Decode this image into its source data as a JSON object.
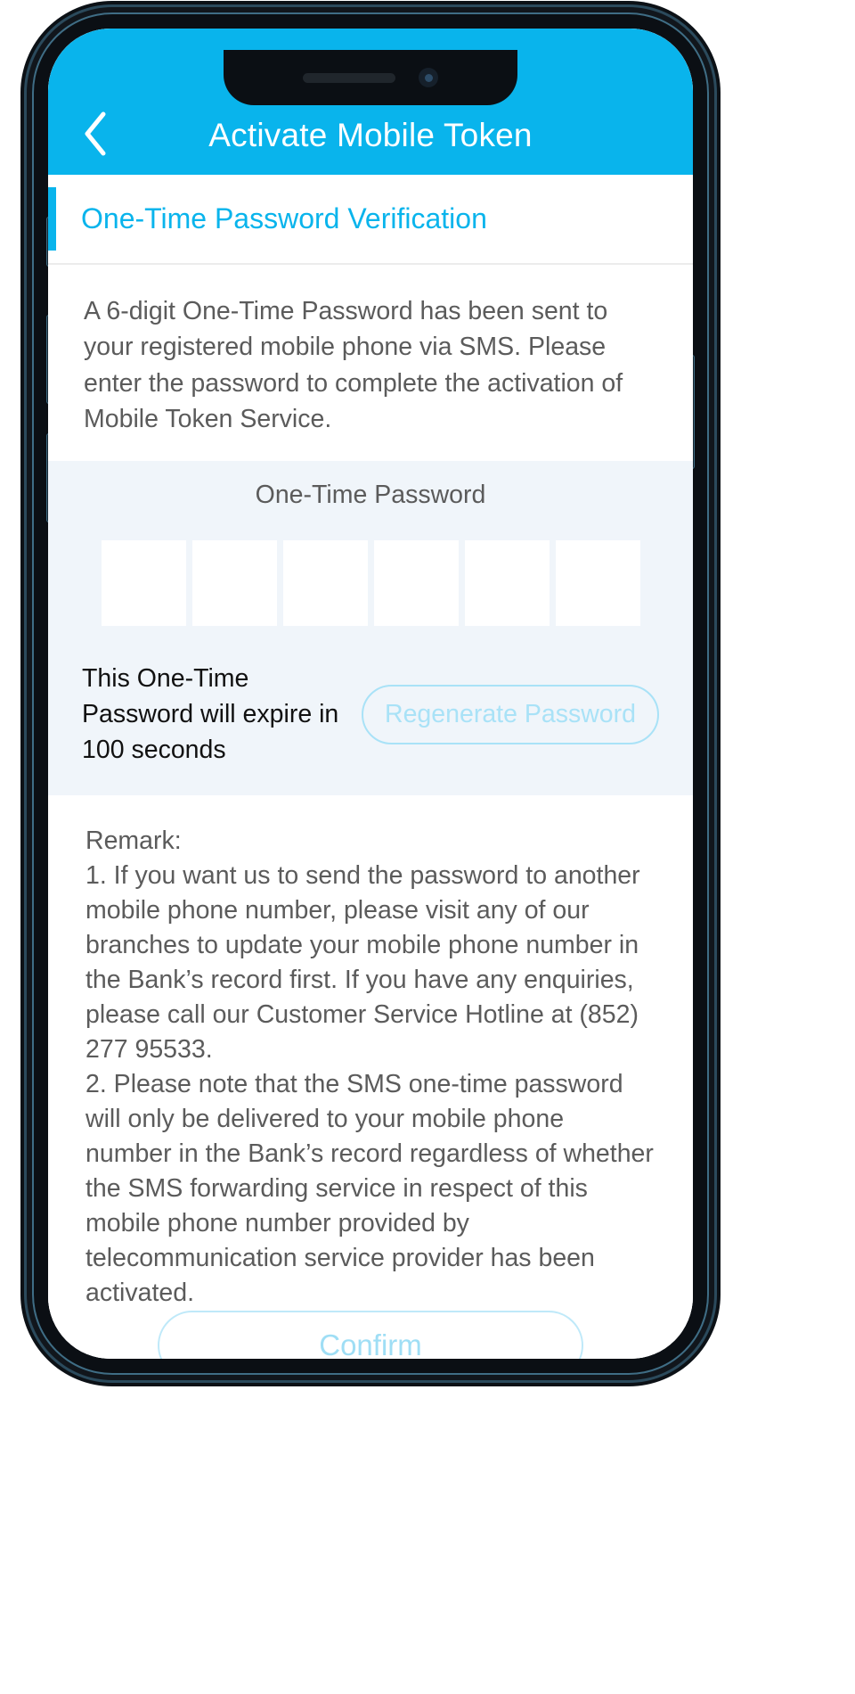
{
  "device": {
    "speaker_name": "earpiece-speaker",
    "camera_name": "front-camera"
  },
  "colors": {
    "brand_blue": "#09b4ec",
    "panel_bg": "#f0f5fa",
    "body_text": "#5b5b5b",
    "disabled_blue": "#a9e2f7",
    "confirm_border": "#bfe9f9"
  },
  "navbar": {
    "back_icon": "chevron-left-icon",
    "title": "Activate Mobile Token"
  },
  "section": {
    "title": "One-Time Password Verification"
  },
  "intro": {
    "text": "A 6-digit One-Time Password has been sent to your registered mobile phone via SMS. Please enter the password to complete the activation of Mobile Token Service."
  },
  "otp": {
    "label": "One-Time Password",
    "digit_count": 6,
    "digits": [
      "",
      "",
      "",
      "",
      "",
      ""
    ],
    "placeholder": "",
    "expire_text": "This One-Time Password will expire in  100 seconds",
    "expire_seconds": "100",
    "regenerate_label": "Regenerate Password"
  },
  "remark": {
    "heading": "Remark:",
    "items": [
      "1. If you want us to send the password to another mobile phone number, please visit any of our branches to update your mobile phone number in the Bank’s record first. If you have any enquiries, please call our Customer Service Hotline at (852) 277 95533.",
      "2. Please note that the SMS one-time password will only be delivered to your mobile phone number in the Bank’s record regardless of whether the SMS forwarding service in respect of this mobile phone number provided by telecommunication service provider has been activated."
    ]
  },
  "footer": {
    "confirm_label": "Confirm"
  }
}
